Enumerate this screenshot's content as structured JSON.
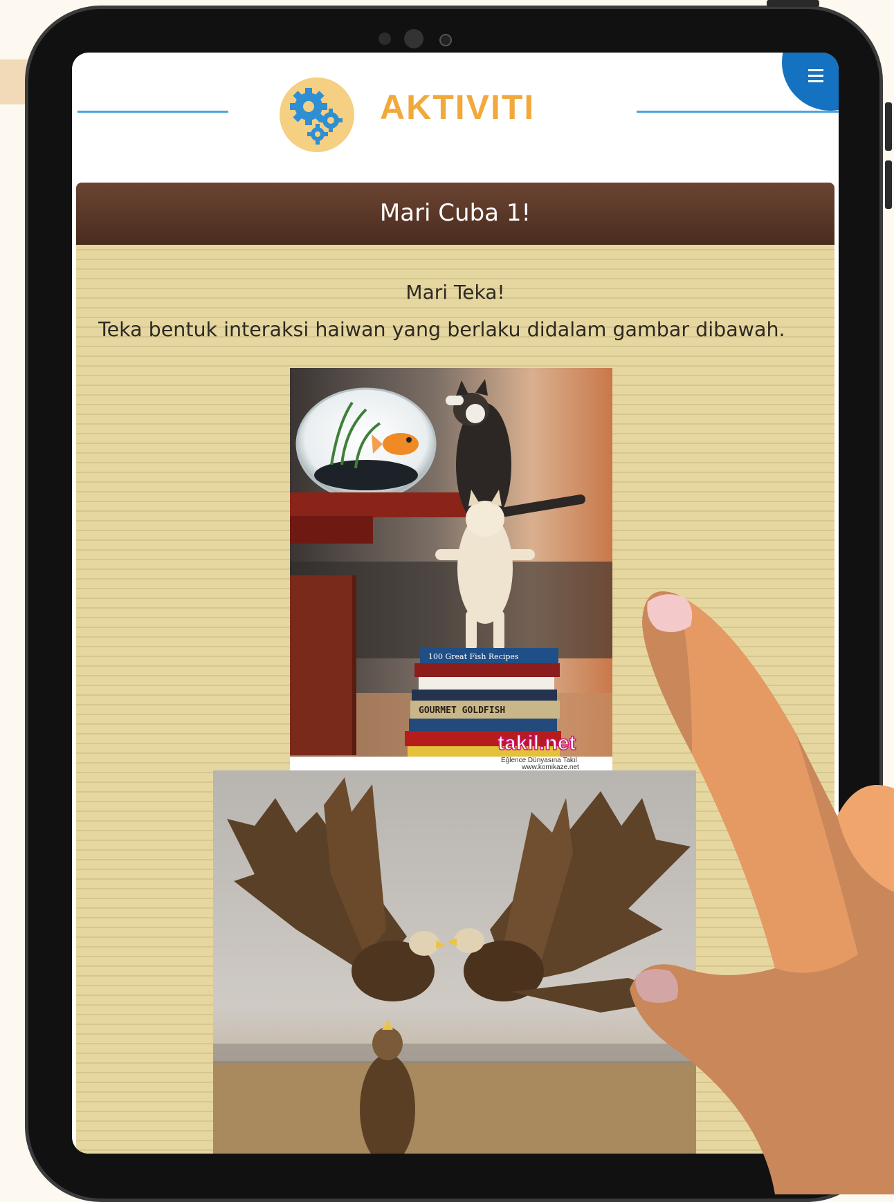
{
  "header": {
    "title": "AKTIVITI",
    "logo_icon": "gears-icon",
    "menu_icon": "hamburger-menu-icon"
  },
  "card": {
    "title": "Mari Cuba 1!",
    "heading": "Mari Teka!",
    "instruction": "Teka bentuk interaksi haiwan yang berlaku didalam gambar dibawah."
  },
  "image1": {
    "book_titles": [
      "100 Great Fish Recipes",
      "GOURMET GOLDFISH"
    ],
    "watermark": "takil.net",
    "watermark_tagline": "Eğlence Dünyasına Takıl",
    "watermark_url": "www.komikaze.net"
  },
  "colors": {
    "accent_orange": "#f1a93b",
    "accent_blue": "#1572c0",
    "card_header_brown": "#5a3727",
    "card_paper": "#e6d7a1"
  }
}
